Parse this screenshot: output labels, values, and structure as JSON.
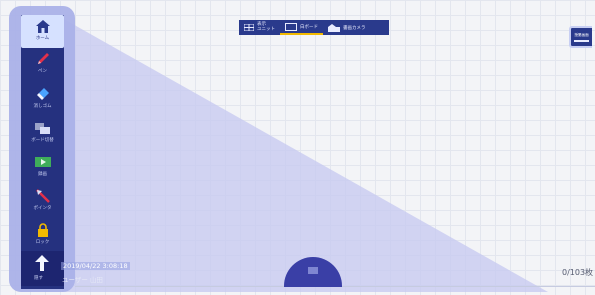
{
  "toolbar": {
    "buttons": [
      {
        "id": "view",
        "label": "表示\nユニット",
        "icon": "grid-icon"
      },
      {
        "id": "white",
        "label": "白ボード",
        "icon": "whiteboard-icon",
        "selected": true
      },
      {
        "id": "camera",
        "label": "書画カメラ",
        "icon": "camera-icon"
      }
    ]
  },
  "sidebar": {
    "tools": [
      {
        "key": "home",
        "label": "ホーム",
        "icon": "home-icon"
      },
      {
        "key": "pen",
        "label": "ペン",
        "icon": "pen-icon"
      },
      {
        "key": "eraser",
        "label": "消しゴム",
        "icon": "eraser-icon"
      },
      {
        "key": "board",
        "label": "ボード切替",
        "icon": "board-icon"
      },
      {
        "key": "record",
        "label": "録画",
        "icon": "video-icon"
      },
      {
        "key": "pointer",
        "label": "ポインタ",
        "icon": "pointer-icon"
      },
      {
        "key": "lock",
        "label": "ロック",
        "icon": "lock-icon"
      },
      {
        "key": "up",
        "label": "隠す",
        "icon": "arrow-up-icon"
      }
    ]
  },
  "right_panel": {
    "label": "授業画面"
  },
  "status": {
    "datetime": "2019/04/22 3:08:18",
    "user": "ユーザー 山田",
    "pages": "0/103枚"
  },
  "colors": {
    "sidebar": "#25317f",
    "sidebar_frame": "#aab1e8",
    "toolbar": "#2a3a8c",
    "overlay": "#c9cbf1",
    "accent": "#f2b900"
  }
}
